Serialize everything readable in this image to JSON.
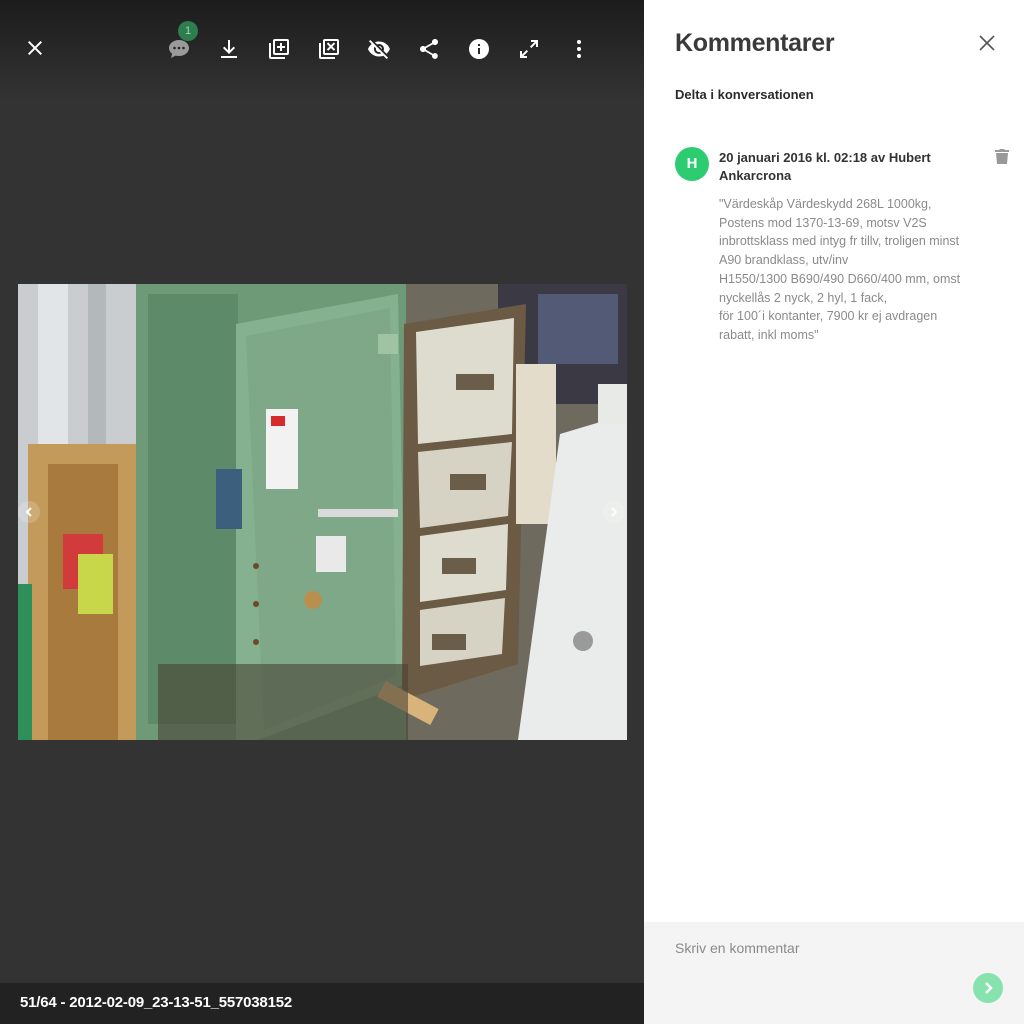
{
  "toolbar": {
    "comments_count": "1",
    "icons": [
      "close-icon",
      "comment-icon",
      "download-icon",
      "add-to-album-icon",
      "remove-from-album-icon",
      "hide-icon",
      "share-icon",
      "info-icon",
      "fullscreen-icon",
      "more-icon"
    ],
    "icon_color": "#ffffff",
    "badge_color": "#2e7d4f"
  },
  "photo": {
    "subject": "green safe and filing cabinet"
  },
  "caption": "51/64 - 2012-02-09_23-13-51_557038152",
  "panel": {
    "title": "Kommentarer",
    "subtitle": "Delta i konversationen",
    "comment": {
      "avatar_letter": "H",
      "avatar_color": "#2ecc71",
      "meta": "20 januari 2016 kl. 02:18 av Hubert Ankarcrona",
      "body": "\"Värdeskåp Värdeskydd 268L 1000kg, Postens mod 1370-13-69, motsv V2S inbrottsklass med intyg fr tillv, troligen minst A90 brandklass, utv/inv\nH1550/1300 B690/490 D660/400 mm, omst nyckellås 2 nyck, 2 hyl, 1 fack,\nför 100´i kontanter, 7900 kr ej avdragen rabatt, inkl moms\""
    },
    "input_placeholder": "Skriv en kommentar",
    "send_color": "#86e3ae"
  }
}
